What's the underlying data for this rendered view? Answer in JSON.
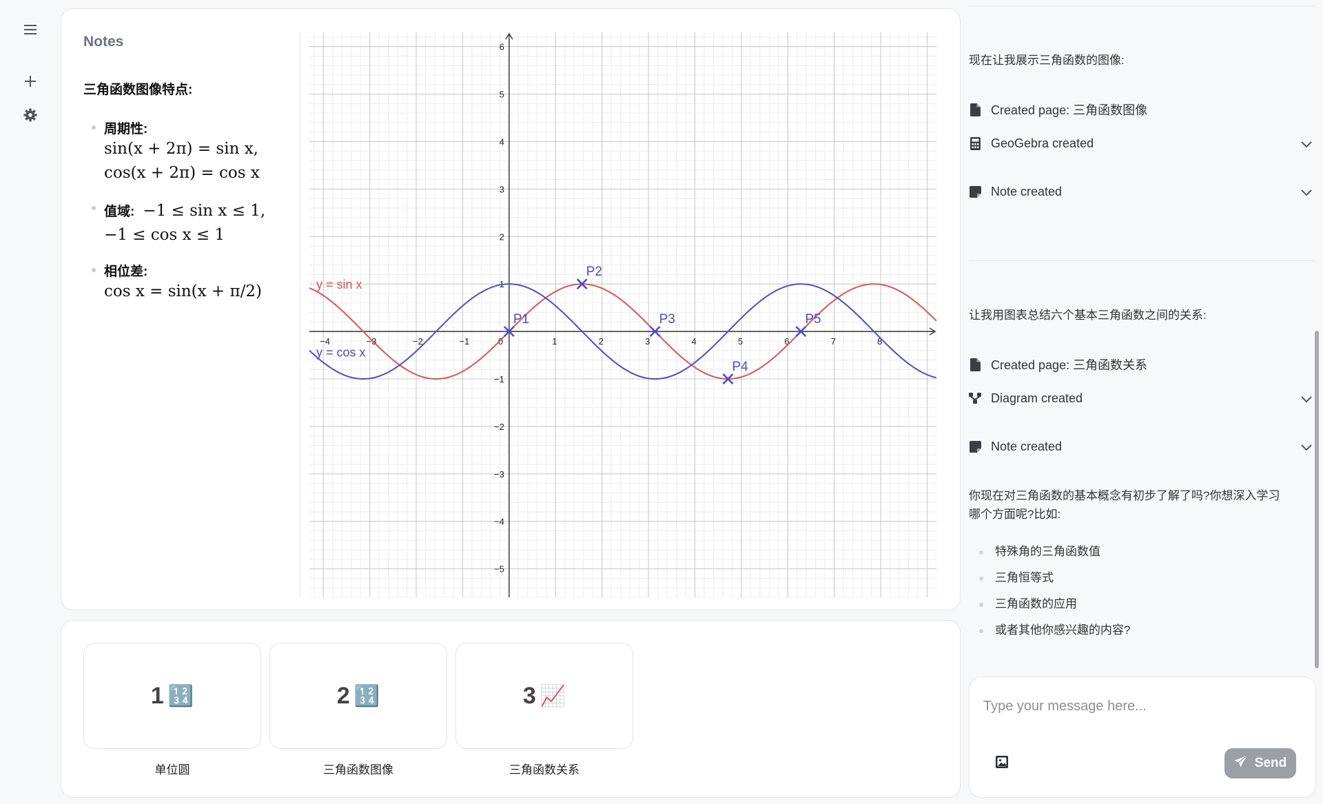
{
  "sidebar": {
    "icons": [
      "menu-icon",
      "plus-icon",
      "gear-icon"
    ]
  },
  "notes": {
    "title": "Notes",
    "heading": "三角函数图像特点:",
    "items": [
      {
        "label": "周期性:",
        "formula_line1": "sin(x + 2π) = sin x,",
        "formula_line2": "cos(x + 2π) = cos x"
      },
      {
        "label": "值域:",
        "formula_line1": "−1 ≤ sin x ≤ 1,",
        "formula_line2": "−1 ≤ cos x ≤ 1"
      },
      {
        "label": "相位差:",
        "formula_line1": "cos x = sin(x + π/2)"
      }
    ]
  },
  "chart_data": {
    "type": "line",
    "xlim": [
      -4.3,
      9.2
    ],
    "ylim": [
      -5.6,
      6.3
    ],
    "x_ticks": [
      -4,
      -3,
      -2,
      -1,
      0,
      1,
      2,
      3,
      4,
      5,
      6,
      7,
      8
    ],
    "y_ticks": [
      -5,
      -4,
      -3,
      -2,
      -1,
      1,
      2,
      3,
      4,
      5,
      6
    ],
    "grid": true,
    "series": [
      {
        "name": "y = sin x",
        "function": "sin",
        "color": "#e15454"
      },
      {
        "name": "y = cos x",
        "function": "cos",
        "color": "#4b4bd6"
      }
    ],
    "points": [
      {
        "label": "P1",
        "x": 0,
        "y": 0
      },
      {
        "label": "P2",
        "x": 1.5708,
        "y": 1
      },
      {
        "label": "P3",
        "x": 3.1416,
        "y": 0
      },
      {
        "label": "P4",
        "x": 4.7124,
        "y": -1
      },
      {
        "label": "P5",
        "x": 6.2832,
        "y": 0
      }
    ],
    "point_color": "#4b4bd6"
  },
  "pages": [
    {
      "number": "1",
      "emoji": "🔢",
      "label": "单位圆"
    },
    {
      "number": "2",
      "emoji": "🔢",
      "label": "三角函数图像"
    },
    {
      "number": "3",
      "emoji": "📈",
      "label": "三角函数关系"
    }
  ],
  "chat": {
    "msg1": "现在让我展示三角函数的图像:",
    "tool1_page": "Created page: 三角函数图像",
    "tool1_geogebra": "GeoGebra created",
    "tool1_note": "Note created",
    "msg2": "让我用图表总结六个基本三角函数之间的关系:",
    "tool2_page": "Created page: 三角函数关系",
    "tool2_diagram": "Diagram created",
    "tool2_note": "Note created",
    "msg3_line1": "你现在对三角函数的基本概念有初步了解了吗?你想深入学习",
    "msg3_line2": "哪个方面呢?比如:",
    "suggestions": [
      "特殊角的三角函数值",
      "三角恒等式",
      "三角函数的应用",
      "或者其他你感兴趣的内容?"
    ],
    "input_placeholder": "Type your message here...",
    "send_label": "Send"
  }
}
